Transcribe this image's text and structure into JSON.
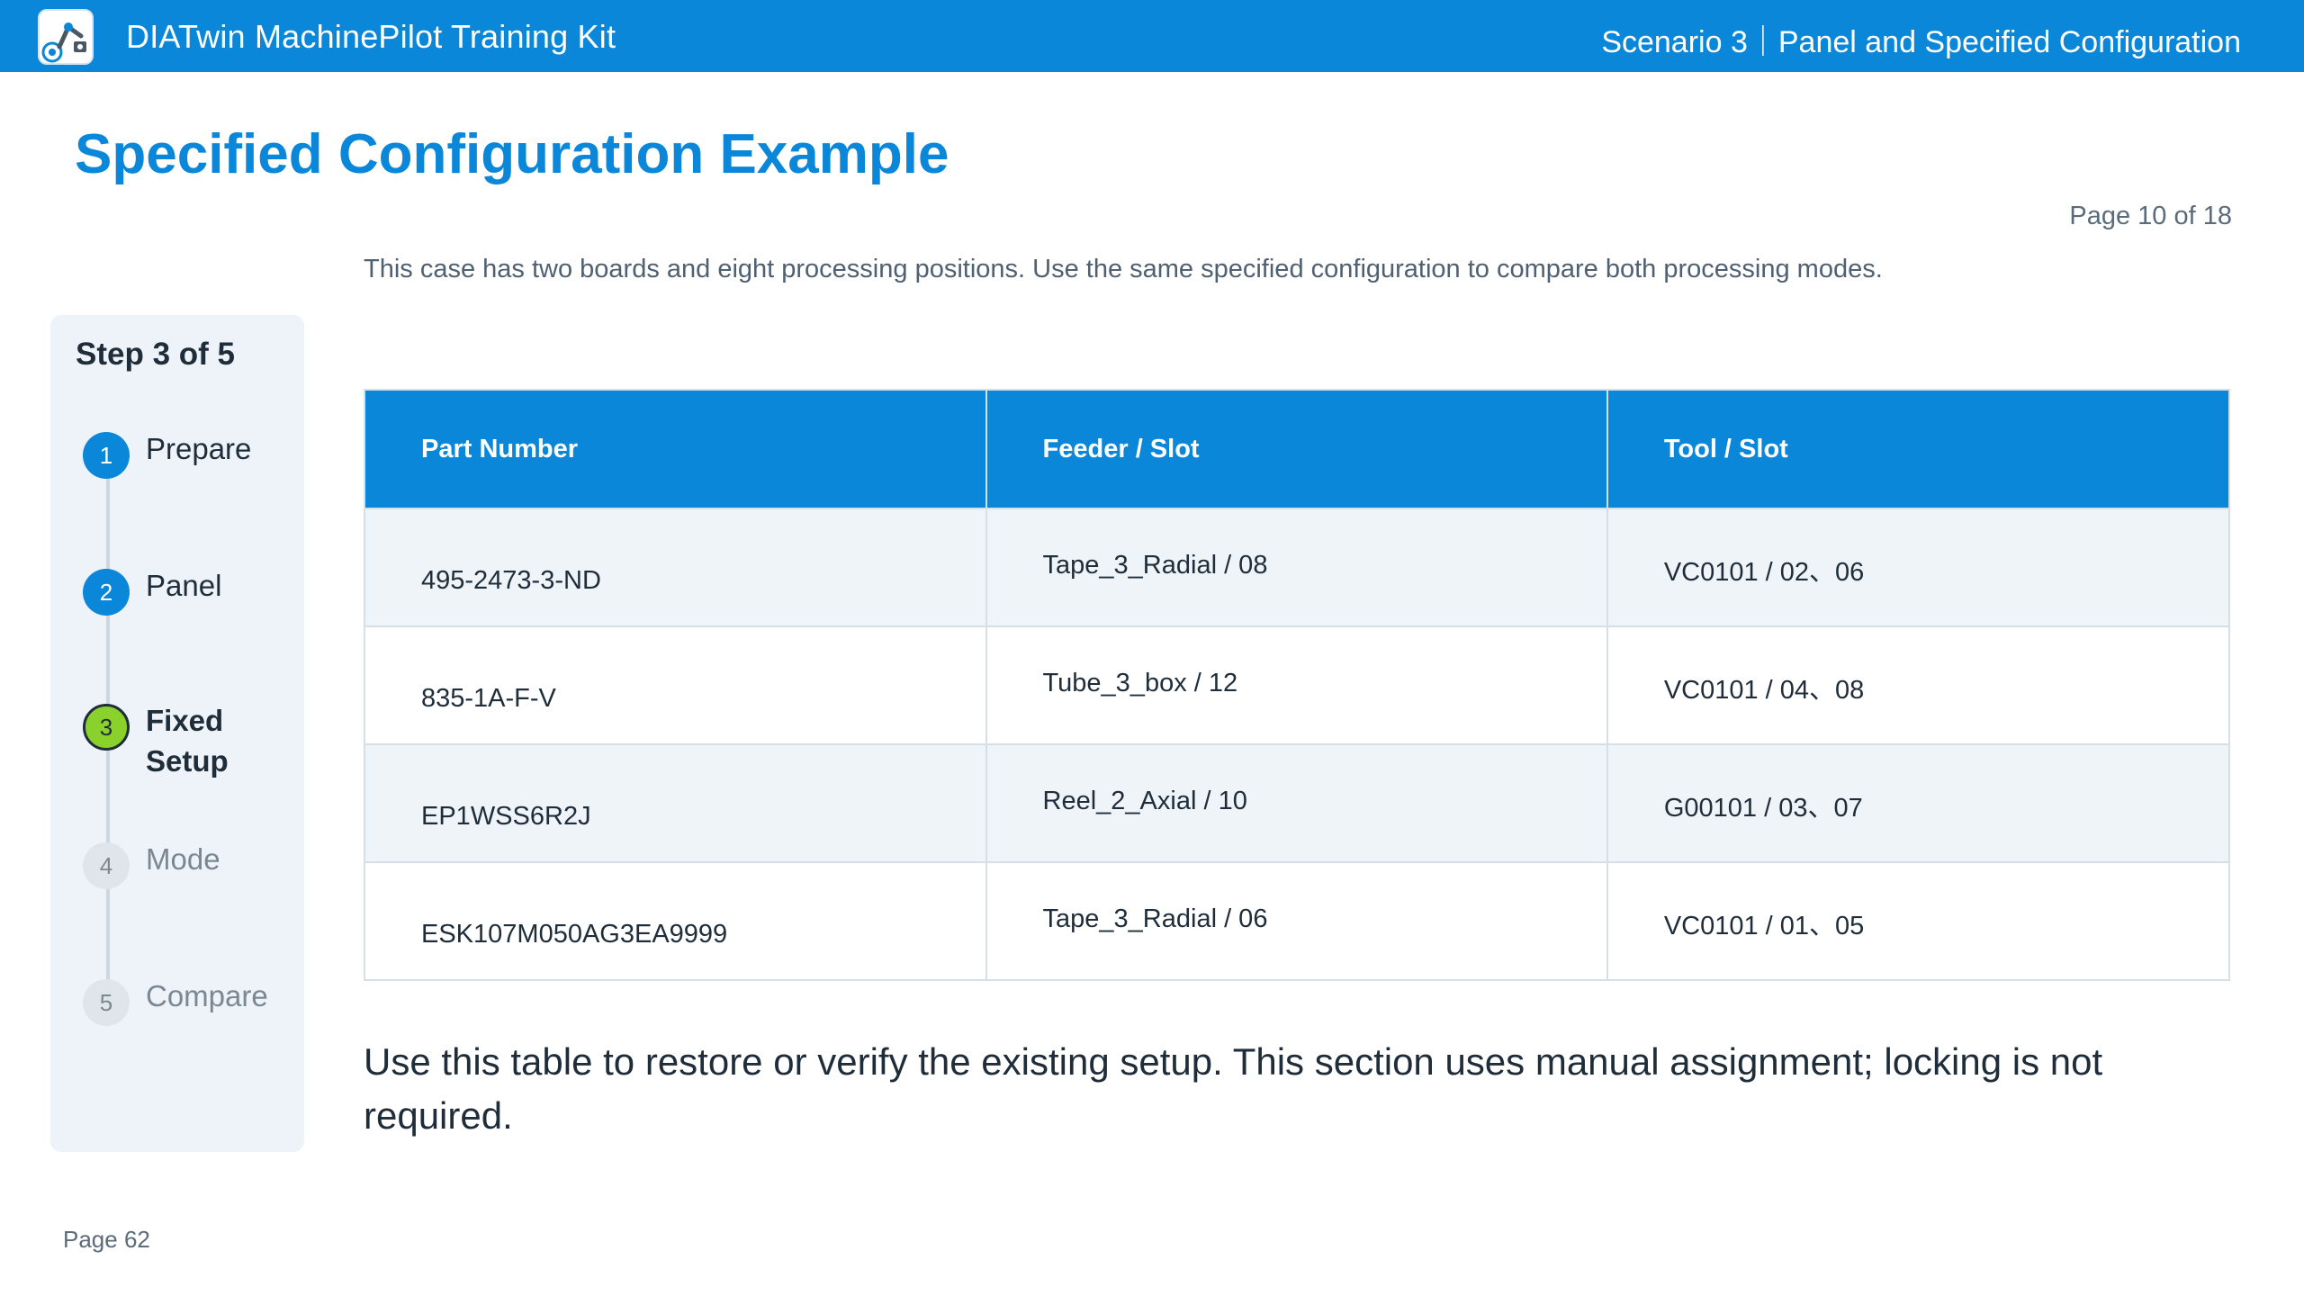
{
  "header": {
    "app_title": "DIATwin MachinePilot Training Kit",
    "scenario": "Scenario 3｜Panel and Specified Configuration",
    "logo_icon": "robot-arm-logo-icon"
  },
  "page": {
    "title": "Specified Configuration Example",
    "counter": "Page 10 of 18",
    "intro": "This case has two boards and eight processing positions. Use the same specified configuration to compare both processing modes."
  },
  "sidebar": {
    "heading": "Step 3 of 5",
    "steps": [
      {
        "num": "1",
        "label": "Prepare",
        "state": "done"
      },
      {
        "num": "2",
        "label": "Panel",
        "state": "done"
      },
      {
        "num": "3",
        "label": "Fixed Setup",
        "state": "current"
      },
      {
        "num": "4",
        "label": "Mode",
        "state": "todo"
      },
      {
        "num": "5",
        "label": "Compare",
        "state": "todo"
      }
    ]
  },
  "table": {
    "headers": [
      "Part Number",
      "Feeder / Slot",
      "Tool / Slot"
    ],
    "rows": [
      [
        "495-2473-3-ND",
        "Tape_3_Radial / 08",
        "VC0101 / 02、06"
      ],
      [
        "835-1A-F-V",
        "Tube_3_box / 12",
        "VC0101 / 04、08"
      ],
      [
        "EP1WSS6R2J",
        "Reel_2_Axial / 10",
        "G00101 / 03、07"
      ],
      [
        "ESK107M050AG3EA9999",
        "Tape_3_Radial / 06",
        "VC0101 / 01、05"
      ]
    ]
  },
  "note": "Use this table to restore or verify the existing setup. This section uses manual assignment; locking is not required.",
  "footer": {
    "page": "Page 62"
  },
  "colors": {
    "accent": "#0b87da",
    "current_step": "#8ad22b",
    "row_alt": "#eef4f8"
  }
}
